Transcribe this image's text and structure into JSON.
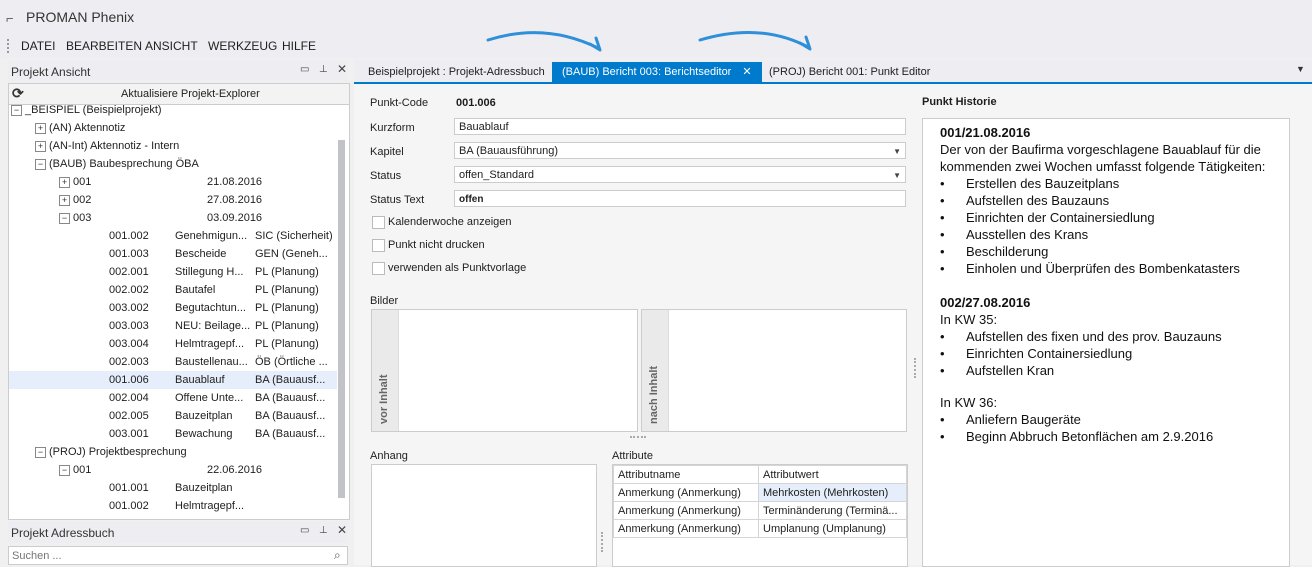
{
  "app": {
    "title": "PROMAN Phenix",
    "logo_icon": "app-logo-icon"
  },
  "menu": [
    "DATEI",
    "BEARBEITEN",
    "ANSICHT",
    "WERKZEUG",
    "HILFE"
  ],
  "left_panel": {
    "title": "Projekt Ansicht",
    "refresh_label": "Aktualisiere Projekt-Explorer",
    "tree": [
      {
        "label": "_BEISPIEL (Beispielprojekt)",
        "indent": 0,
        "toggle": "−",
        "c2": "",
        "c3": ""
      },
      {
        "label": "(AN) Aktennotiz",
        "indent": 1,
        "toggle": "+",
        "c2": "",
        "c3": ""
      },
      {
        "label": "(AN-Int) Aktennotiz - Intern",
        "indent": 1,
        "toggle": "+",
        "c2": "",
        "c3": ""
      },
      {
        "label": "(BAUB) Baubesprechung ÖBA",
        "indent": 1,
        "toggle": "−",
        "c2": "",
        "c3": ""
      },
      {
        "label": "001",
        "indent": 2,
        "toggle": "+",
        "c2": "21.08.2016",
        "c3": ""
      },
      {
        "label": "002",
        "indent": 2,
        "toggle": "+",
        "c2": "27.08.2016",
        "c3": ""
      },
      {
        "label": "003",
        "indent": 2,
        "toggle": "−",
        "c2": "03.09.2016",
        "c3": ""
      },
      {
        "label": "001.002",
        "indent": 3,
        "toggle": "",
        "c2": "Genehmigun...",
        "c3": "SIC (Sicherheit)"
      },
      {
        "label": "001.003",
        "indent": 3,
        "toggle": "",
        "c2": "Bescheide",
        "c3": "GEN (Geneh..."
      },
      {
        "label": "002.001",
        "indent": 3,
        "toggle": "",
        "c2": "Stillegung H...",
        "c3": "PL (Planung)"
      },
      {
        "label": "002.002",
        "indent": 3,
        "toggle": "",
        "c2": "Bautafel",
        "c3": "PL (Planung)"
      },
      {
        "label": "003.002",
        "indent": 3,
        "toggle": "",
        "c2": "Begutachtun...",
        "c3": "PL (Planung)"
      },
      {
        "label": "003.003",
        "indent": 3,
        "toggle": "",
        "c2": "NEU: Beilage...",
        "c3": "PL (Planung)"
      },
      {
        "label": "003.004",
        "indent": 3,
        "toggle": "",
        "c2": "Helmtragepf...",
        "c3": "PL (Planung)"
      },
      {
        "label": "002.003",
        "indent": 3,
        "toggle": "",
        "c2": "Baustellenau...",
        "c3": "ÖB (Örtliche ..."
      },
      {
        "label": "001.006",
        "indent": 3,
        "toggle": "",
        "c2": "Bauablauf",
        "c3": "BA (Bauausf...",
        "selected": true
      },
      {
        "label": "002.004",
        "indent": 3,
        "toggle": "",
        "c2": "Offene Unte...",
        "c3": "BA (Bauausf..."
      },
      {
        "label": "002.005",
        "indent": 3,
        "toggle": "",
        "c2": "Bauzeitplan",
        "c3": "BA (Bauausf..."
      },
      {
        "label": "003.001",
        "indent": 3,
        "toggle": "",
        "c2": "Bewachung",
        "c3": "BA (Bauausf..."
      },
      {
        "label": "(PROJ) Projektbesprechung",
        "indent": 1,
        "toggle": "−",
        "c2": "",
        "c3": ""
      },
      {
        "label": "001",
        "indent": 2,
        "toggle": "−",
        "c2": "22.06.2016",
        "c3": ""
      },
      {
        "label": "001.001",
        "indent": 3,
        "toggle": "",
        "c2": "Bauzeitplan",
        "c3": ""
      },
      {
        "label": "001.002",
        "indent": 3,
        "toggle": "",
        "c2": "Helmtragepf...",
        "c3": ""
      }
    ]
  },
  "address_panel": {
    "title": "Projekt Adressbuch",
    "search_placeholder": "Suchen ..."
  },
  "tabs": [
    {
      "label": "Beispielprojekt : Projekt-Adressbuch",
      "active": false
    },
    {
      "label": "(BAUB) Bericht 003: Berichtseditor",
      "active": true
    },
    {
      "label": "(PROJ) Bericht 001: Punkt Editor",
      "active": false
    }
  ],
  "form": {
    "punkt_code_label": "Punkt-Code",
    "punkt_code": "001.006",
    "kurzform_label": "Kurzform",
    "kurzform": "Bauablauf",
    "kapitel_label": "Kapitel",
    "kapitel": "BA (Bauausführung)",
    "status_label": "Status",
    "status": "offen_Standard",
    "status_text_label": "Status Text",
    "status_text": "offen",
    "cb_kalenderwoche": "Kalenderwoche anzeigen",
    "cb_nicht_drucken": "Punkt nicht drucken",
    "cb_vorlage": "verwenden als Punktvorlage",
    "bilder_label": "Bilder",
    "vor_inhalt": "vor Inhalt",
    "nach_inhalt": "nach Inhalt",
    "anhang_label": "Anhang",
    "attribute_label": "Attribute"
  },
  "attributes": {
    "headers": [
      "Attributname",
      "Attributwert"
    ],
    "rows": [
      [
        "Anmerkung (Anmerkung)",
        "Mehrkosten (Mehrkosten)"
      ],
      [
        "Anmerkung (Anmerkung)",
        "Terminänderung (Terminä..."
      ],
      [
        "Anmerkung (Anmerkung)",
        "Umplanung (Umplanung)"
      ]
    ]
  },
  "history": {
    "title": "Punkt Historie",
    "e1_title": "001/21.08.2016",
    "e1_line1": "Der von der Baufirma vorgeschlagene Bauablauf für die",
    "e1_line2": "kommenden zwei Wochen umfasst folgende Tätigkeiten:",
    "e1_bullets": [
      "Erstellen des Bauzeitplans",
      "Aufstellen des Bauzauns",
      "Einrichten der Containersiedlung",
      "Ausstellen des Krans",
      "Beschilderung",
      "Einholen und Überprüfen des Bombenkatasters"
    ],
    "e2_title": "002/27.08.2016",
    "e2_kw35": "In KW 35:",
    "e2_bullets_a": [
      "Aufstellen des fixen und des prov. Bauzauns",
      "Einrichten Containersiedlung",
      "Aufstellen Kran"
    ],
    "e2_kw36": "In KW 36:",
    "e2_bullets_b": [
      "Anliefern Baugeräte",
      "Beginn Abbruch Betonflächen am 2.9.2016"
    ]
  },
  "colors": {
    "accent": "#007acc",
    "arrow": "#2f8fd8",
    "selected_row": "#e5eefa"
  }
}
